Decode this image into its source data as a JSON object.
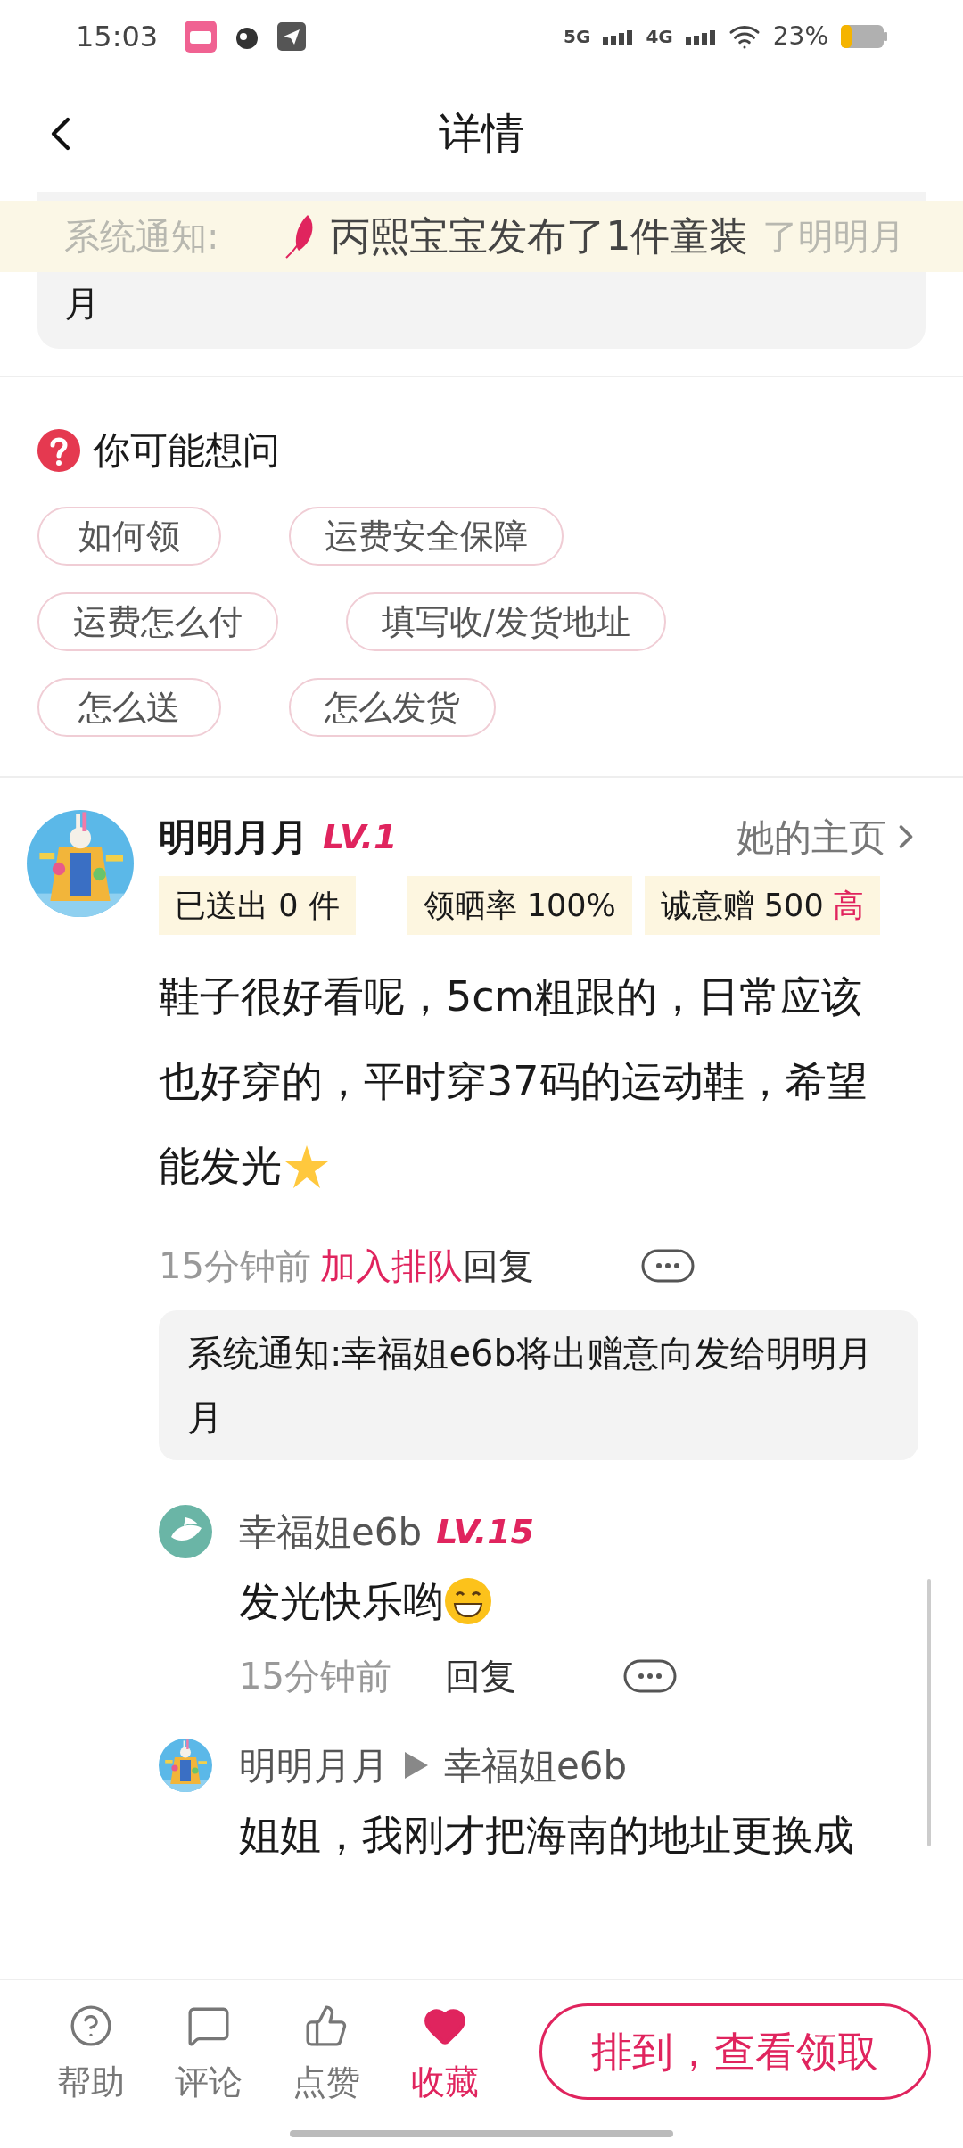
{
  "status_bar": {
    "time": "15:03",
    "signal_1": "5G",
    "signal_2": "4G",
    "battery": "23%"
  },
  "header": {
    "title": "详情"
  },
  "notice_card": {
    "line_1_start": "系统通知:",
    "line_1_end": "了明明月",
    "line_2": "月"
  },
  "toast": {
    "text": "丙熙宝宝发布了1件童装"
  },
  "faq": {
    "title": "你可能想问",
    "rows": [
      [
        "如何领",
        "运费安全保障"
      ],
      [
        "运费怎么付",
        "填写收/发货地址"
      ],
      [
        "怎么送",
        "怎么发货"
      ]
    ]
  },
  "comment": {
    "author": "明明月月",
    "level": "LV.1",
    "profile_link": "她的主页",
    "stats": [
      {
        "text": "已送出 0 件"
      },
      {
        "text": "领晒率 100%"
      },
      {
        "text": "诚意赠 500",
        "badge": "高"
      }
    ],
    "body": [
      "鞋子很好看呢，5cm粗跟的，日常应该",
      "也好穿的，平时穿37码的运动鞋，希望",
      "能发光"
    ],
    "time": "15分钟前",
    "queue_link": "加入排队",
    "reply": "回复",
    "system_note": "系统通知:幸福姐e6b将出赠意向发给明明月月",
    "replies": [
      {
        "kind": "leaf",
        "author": "幸福姐e6b",
        "level": "LV.15",
        "text": "发光快乐哟",
        "time": "15分钟前",
        "reply": "回复"
      },
      {
        "kind": "picture",
        "author": "明明月月",
        "to": "幸福姐e6b",
        "text": "姐姐，我刚才把海南的地址更换成"
      }
    ]
  },
  "bottom_bar": {
    "items": [
      {
        "kind": "help",
        "label": "帮助",
        "selected": false
      },
      {
        "kind": "comment",
        "label": "评论",
        "selected": false
      },
      {
        "kind": "like",
        "label": "点赞",
        "selected": false
      },
      {
        "kind": "favorite",
        "label": "收藏",
        "selected": true
      }
    ],
    "action_button": "排到，查看领取"
  }
}
